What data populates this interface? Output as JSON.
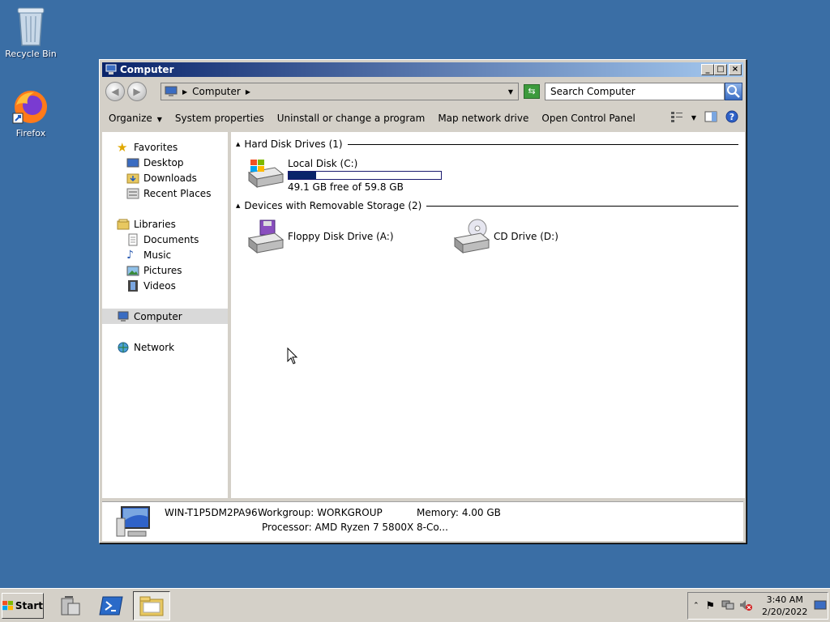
{
  "desktop": {
    "icons": [
      {
        "label": "Recycle Bin",
        "icon": "recycle-bin-icon"
      },
      {
        "label": "Firefox",
        "icon": "firefox-icon"
      }
    ]
  },
  "window": {
    "title": "Computer",
    "controls": {
      "minimize": "_",
      "maximize": "□",
      "close": "×"
    }
  },
  "addressbar": {
    "path": "Computer",
    "search_placeholder": "Search Computer"
  },
  "toolbar": {
    "organize": "Organize",
    "system_properties": "System properties",
    "uninstall": "Uninstall or change a program",
    "map_drive": "Map network drive",
    "control_panel": "Open Control Panel"
  },
  "nav": {
    "favorites": "Favorites",
    "desktop": "Desktop",
    "downloads": "Downloads",
    "recent": "Recent Places",
    "libraries": "Libraries",
    "documents": "Documents",
    "music": "Music",
    "pictures": "Pictures",
    "videos": "Videos",
    "computer": "Computer",
    "network": "Network"
  },
  "content": {
    "hdd_group": "Hard Disk Drives (1)",
    "removable_group": "Devices with Removable Storage (2)",
    "local_disk": {
      "name": "Local Disk (C:)",
      "free": "49.1 GB free of 59.8 GB",
      "used_fraction": 0.18
    },
    "floppy": "Floppy Disk Drive (A:)",
    "cd": "CD Drive (D:)"
  },
  "details": {
    "computer_name": "WIN-T1P5DM2PA96",
    "workgroup_label": "Workgroup:",
    "workgroup": "WORKGROUP",
    "memory_label": "Memory:",
    "memory": "4.00 GB",
    "processor_label": "Processor:",
    "processor": "AMD Ryzen 7 5800X 8-Co..."
  },
  "taskbar": {
    "start": "Start",
    "time": "3:40 AM",
    "date": "2/20/2022"
  },
  "colors": {
    "desktop": "#3a6ea5",
    "titlebar_start": "#0a246a",
    "titlebar_end": "#a6caf0",
    "disk_fill": "#0a246a"
  }
}
